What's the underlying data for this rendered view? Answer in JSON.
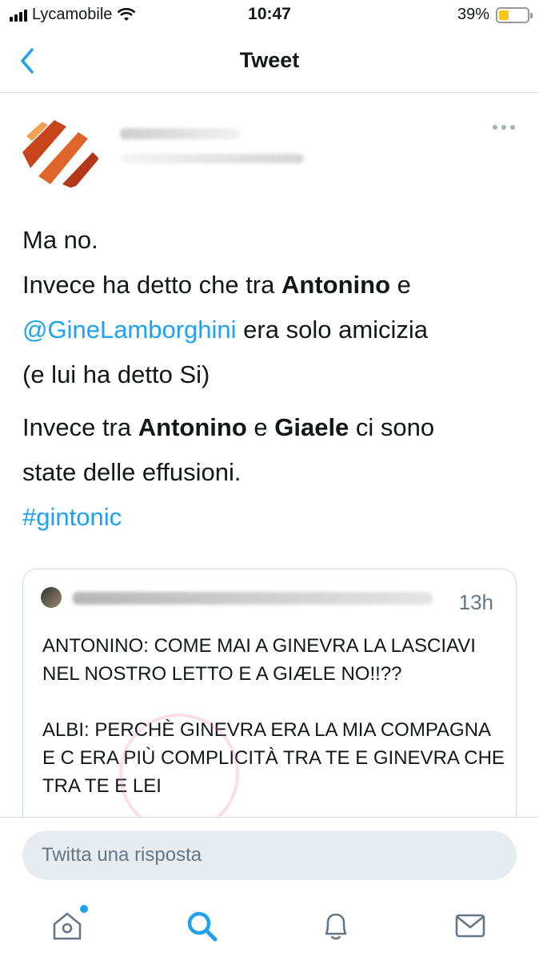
{
  "status_bar": {
    "carrier": "Lycamobile",
    "time": "10:47",
    "battery": "39%",
    "battery_level": 0.39,
    "battery_color": "#f5c518"
  },
  "nav": {
    "back_icon": "chevron-left-icon",
    "title": "Tweet"
  },
  "tweet": {
    "more_icon": "ellipsis-icon",
    "line1": "Ma no.",
    "line2_a": "Invece ha detto che tra ",
    "line2_bold": "Antonino",
    "line2_b": " e",
    "mention": "@GineLamborghini",
    "line3_b": "  era solo amicizia",
    "line4": "(e lui ha detto Si)",
    "p2_a": "Invece tra ",
    "p2_bold1": "Antonino",
    "p2_b": " e ",
    "p2_bold2": "Giaele",
    "p2_c": " ci sono",
    "p2_line2": "state delle effusioni.",
    "hashtag": "#gintonic"
  },
  "quoted_tweet": {
    "time": "13h",
    "text_p1": "ANTONINO: COME MAI A GINEVRA LA LASCIAVI NEL NOSTRO LETTO E A GIÆLE NO!!??",
    "text_p2": "ALBI: PERCHÈ GINEVRA ERA LA MIA COMPAGNA E C ERA PIÙ COMPLICITÀ TRA TE E GINEVRA CHE TRA TE E LEI"
  },
  "reply": {
    "placeholder": "Twitta una risposta"
  },
  "tab_bar": {
    "items": [
      "home-icon",
      "search-icon",
      "bell-icon",
      "mail-icon"
    ],
    "accent": "#1da1f2"
  }
}
